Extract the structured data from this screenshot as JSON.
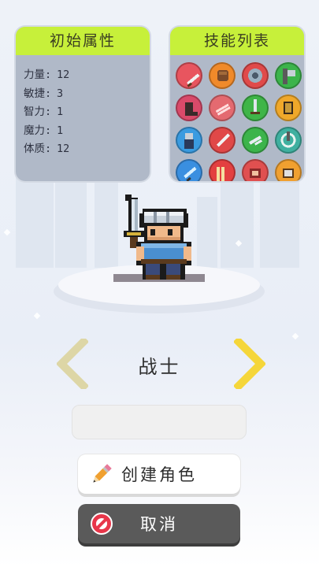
{
  "attributes_panel": {
    "title": "初始属性",
    "rows": [
      {
        "label": "力量:",
        "value": "12"
      },
      {
        "label": "敏捷:",
        "value": "3"
      },
      {
        "label": "智力:",
        "value": "1"
      },
      {
        "label": "魔力:",
        "value": "1"
      },
      {
        "label": "体质:",
        "value": "12"
      }
    ]
  },
  "skills_panel": {
    "title": "技能列表",
    "skills": [
      {
        "icon": "sword-slash-icon",
        "bg": "#e8555f"
      },
      {
        "icon": "fist-icon",
        "bg": "#f08a2a"
      },
      {
        "icon": "shield-spin-icon",
        "bg": "#e04a4a"
      },
      {
        "icon": "axe-swing-icon",
        "bg": "#3cb44b"
      },
      {
        "icon": "boot-icon",
        "bg": "#d94a6a"
      },
      {
        "icon": "blood-slash-icon",
        "bg": "#e46a70"
      },
      {
        "icon": "dagger-icon",
        "bg": "#3fb548"
      },
      {
        "icon": "armor-icon",
        "bg": "#f0a82a"
      },
      {
        "icon": "knight-icon",
        "bg": "#3a9be0"
      },
      {
        "icon": "blade-red-icon",
        "bg": "#e04848"
      },
      {
        "icon": "dash-strike-icon",
        "bg": "#3cb44b"
      },
      {
        "icon": "whirlwind-icon",
        "bg": "#3fb0a0"
      },
      {
        "icon": "ice-sword-icon",
        "bg": "#3a8fe0"
      },
      {
        "icon": "fire-blade-icon",
        "bg": "#e34040"
      },
      {
        "icon": "war-cry-icon",
        "bg": "#e05050"
      },
      {
        "icon": "crush-icon",
        "bg": "#f0a030"
      }
    ]
  },
  "character": {
    "class_name": "战士"
  },
  "name_input": {
    "value": "",
    "placeholder": ""
  },
  "buttons": {
    "create_label": "创建角色",
    "cancel_label": "取消"
  },
  "colors": {
    "header_accent": "#c7f03a",
    "arrow_left": "#ddd6a6",
    "arrow_right": "#f5d63a",
    "cancel_bg": "#5a5a5a"
  }
}
